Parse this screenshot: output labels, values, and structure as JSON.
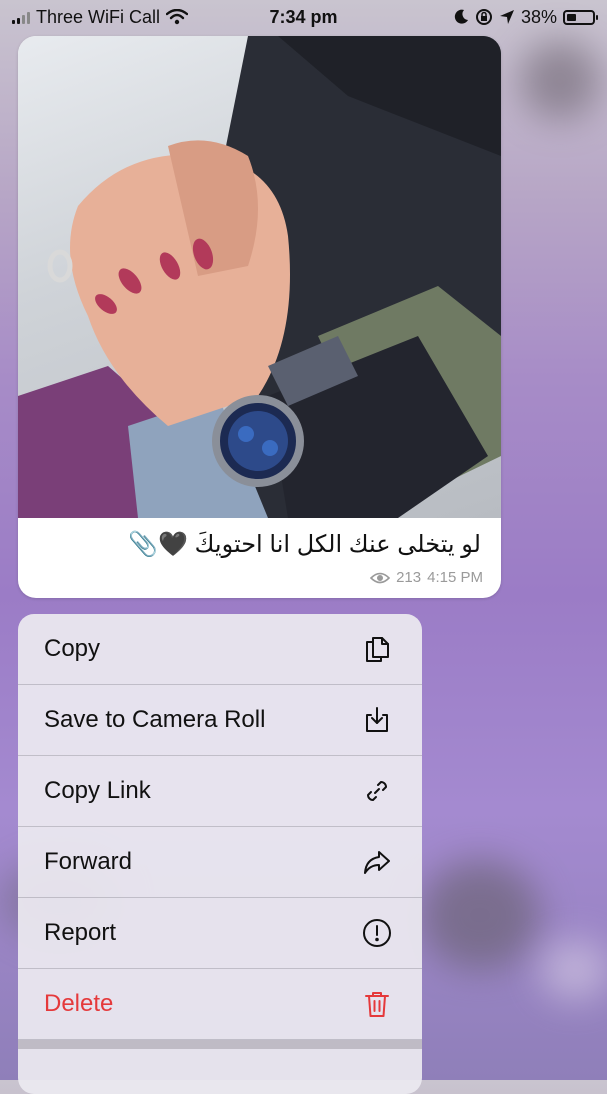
{
  "status_bar": {
    "carrier": "Three WiFi Call",
    "time": "7:34 pm",
    "battery": "38%",
    "battery_level": 0.38
  },
  "message": {
    "caption": "لو يتخلى عنك الكل انا احتويكَ 🖤📎",
    "views": "213",
    "time": "4:15 PM"
  },
  "menu": {
    "items": [
      {
        "label": "Copy",
        "icon": "copy-icon"
      },
      {
        "label": "Save to Camera Roll",
        "icon": "download-icon"
      },
      {
        "label": "Copy Link",
        "icon": "link-icon"
      },
      {
        "label": "Forward",
        "icon": "forward-icon"
      },
      {
        "label": "Report",
        "icon": "exclamation-icon"
      },
      {
        "label": "Delete",
        "icon": "trash-icon",
        "destructive": true
      }
    ]
  },
  "colors": {
    "destructive": "#e5393b",
    "menu_bg": "#ece9f0",
    "background": "#a78cc7"
  }
}
